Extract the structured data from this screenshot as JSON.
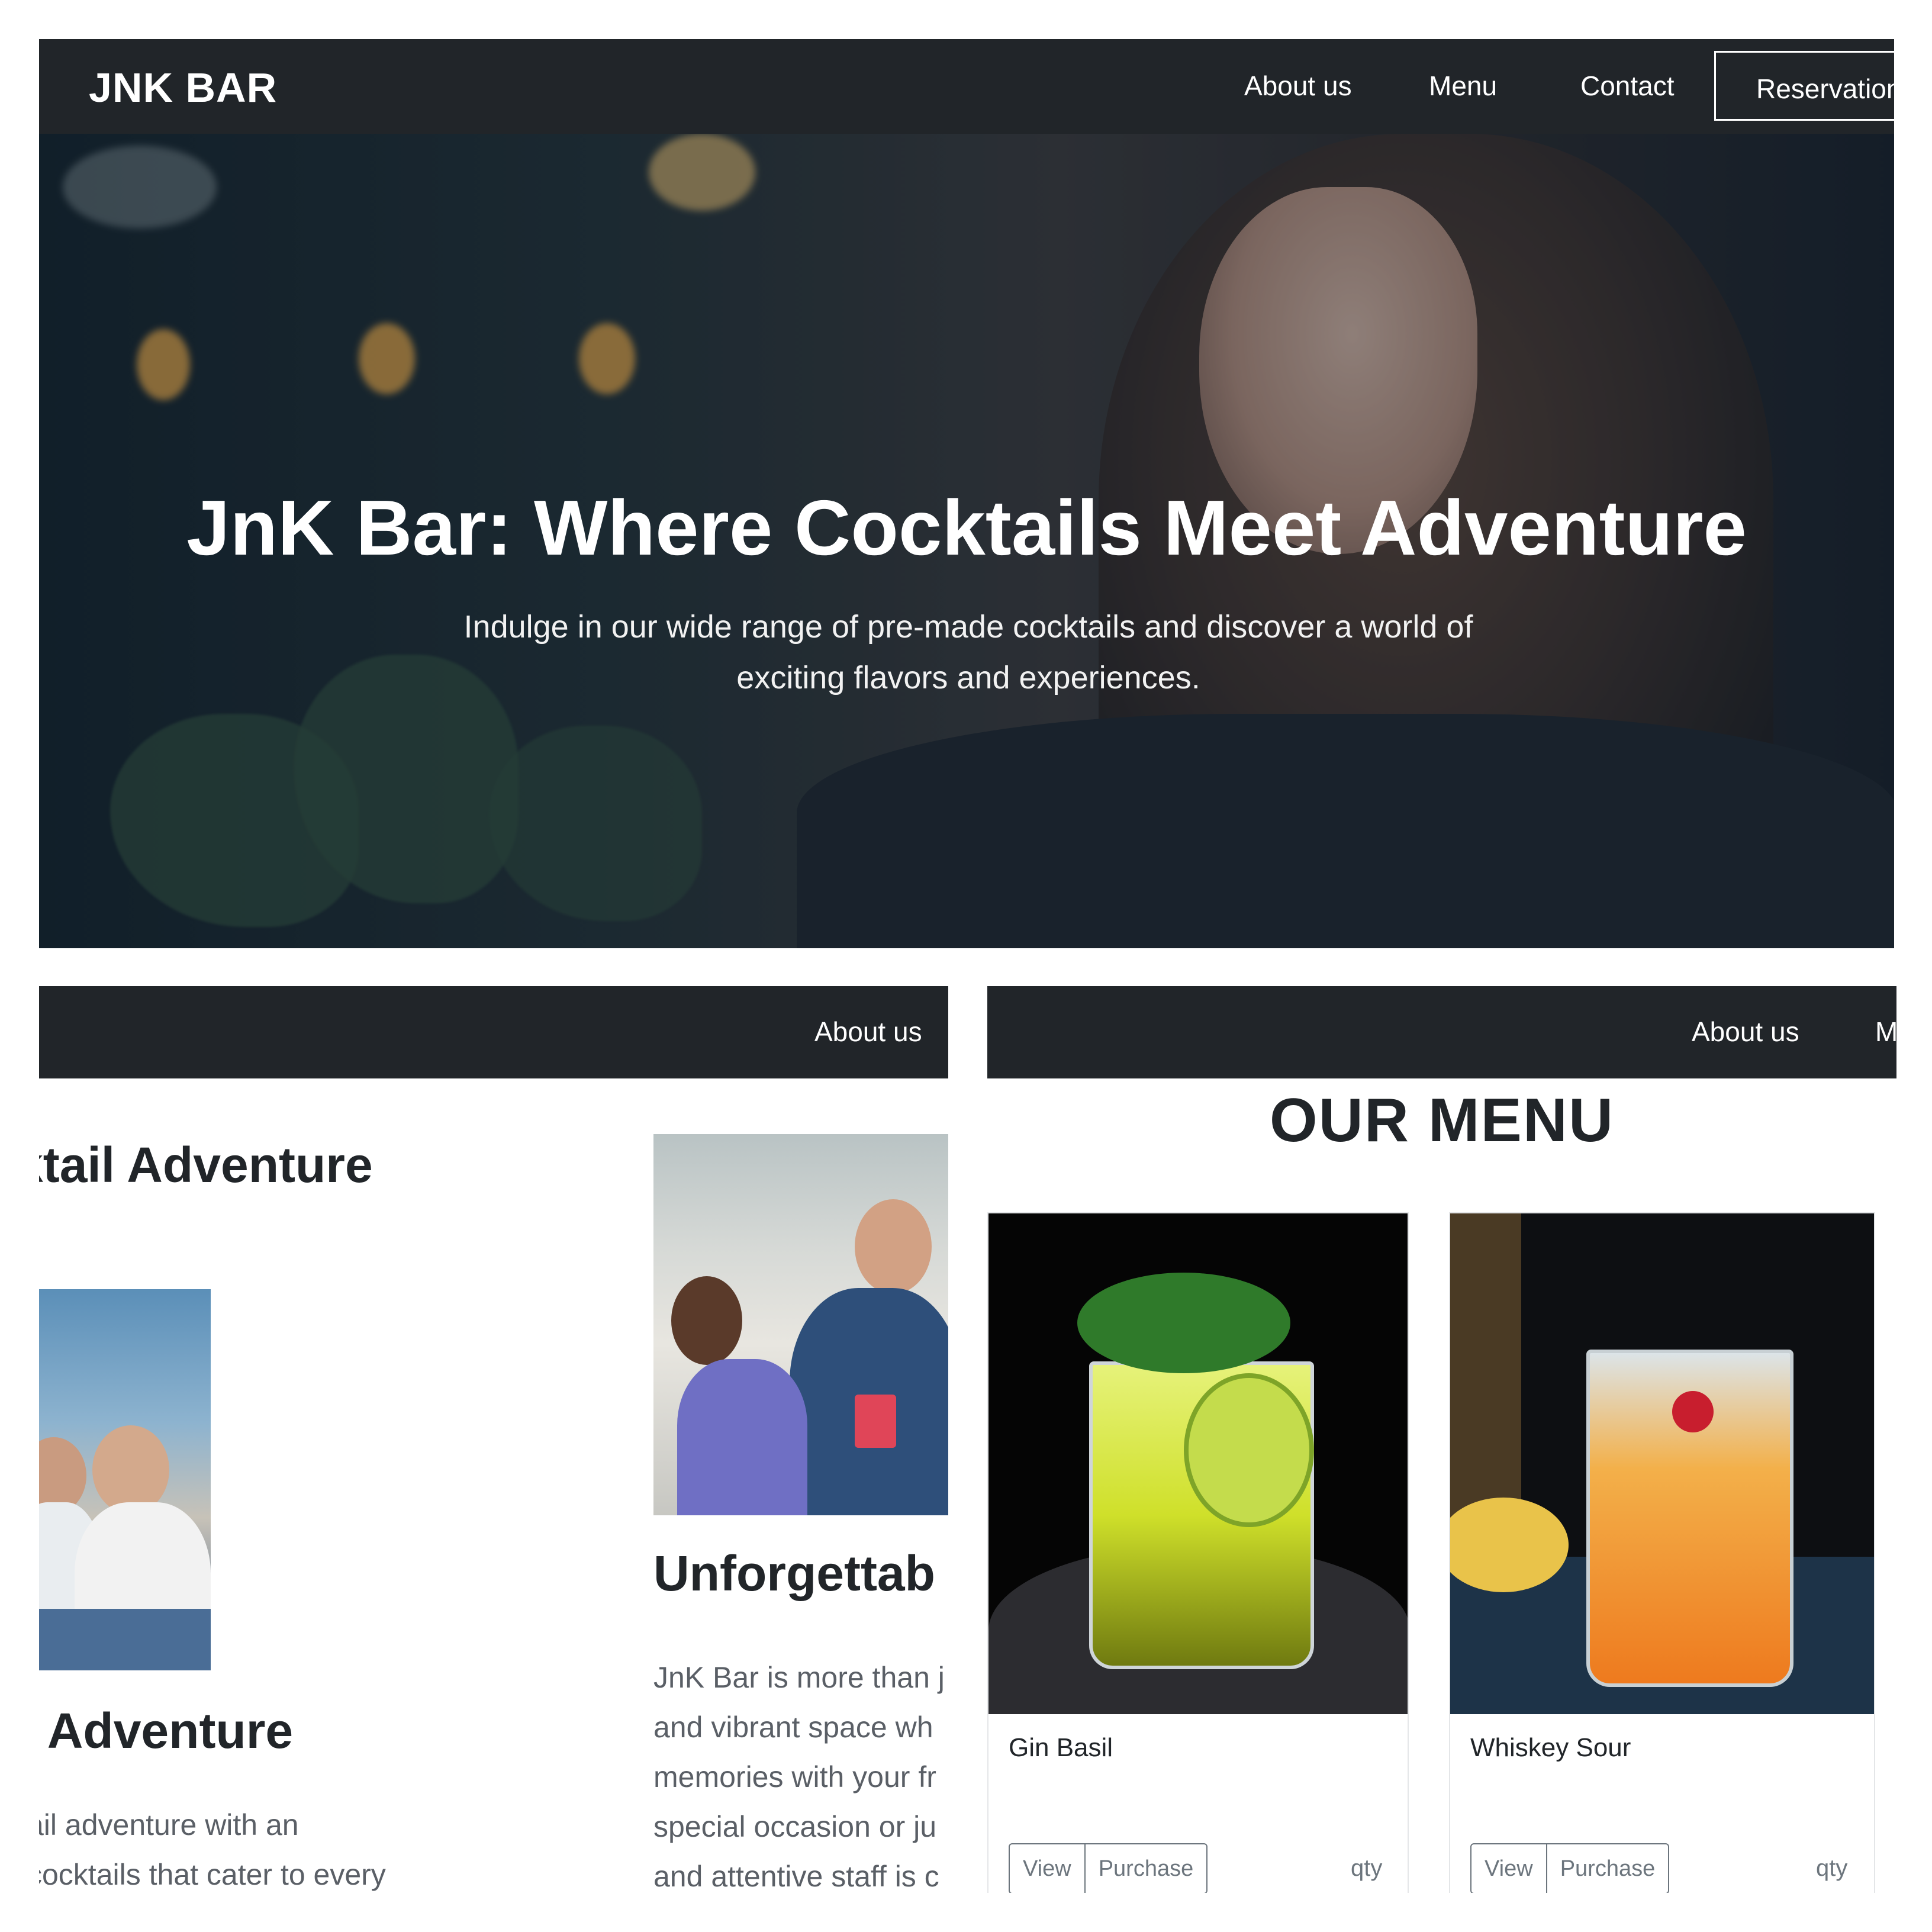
{
  "nav": {
    "brand": "JNK BAR",
    "links": [
      "About us",
      "Menu",
      "Contact"
    ],
    "reservation": "Reservation",
    "partial_link": "M"
  },
  "hero": {
    "title": "JnK Bar: Where Cocktails Meet Adventure",
    "subtitle_line1": "Indulge in our wide range of pre-made cocktails and discover a world of",
    "subtitle_line2": "exciting flavors and experiences."
  },
  "about": {
    "heading_top": "ktail Adventure",
    "heading_bottom": "Adventure",
    "heading_mid": "Unforgettab",
    "para_left": [
      "ail adventure with an",
      "cocktails that cater to every"
    ],
    "para_right": [
      "JnK Bar is more than j",
      "and vibrant space wh",
      "memories with your fr",
      "special occasion or ju",
      "and attentive staff is c"
    ]
  },
  "menu": {
    "title": "OUR MENU",
    "items": [
      {
        "name": "Gin Basil",
        "view": "View",
        "purchase": "Purchase",
        "qty": "qty"
      },
      {
        "name": "Whiskey Sour",
        "view": "View",
        "purchase": "Purchase",
        "qty": "qty"
      }
    ]
  },
  "colors": {
    "navbar": "#212529",
    "text": "#212529",
    "muted": "#6c757d"
  }
}
